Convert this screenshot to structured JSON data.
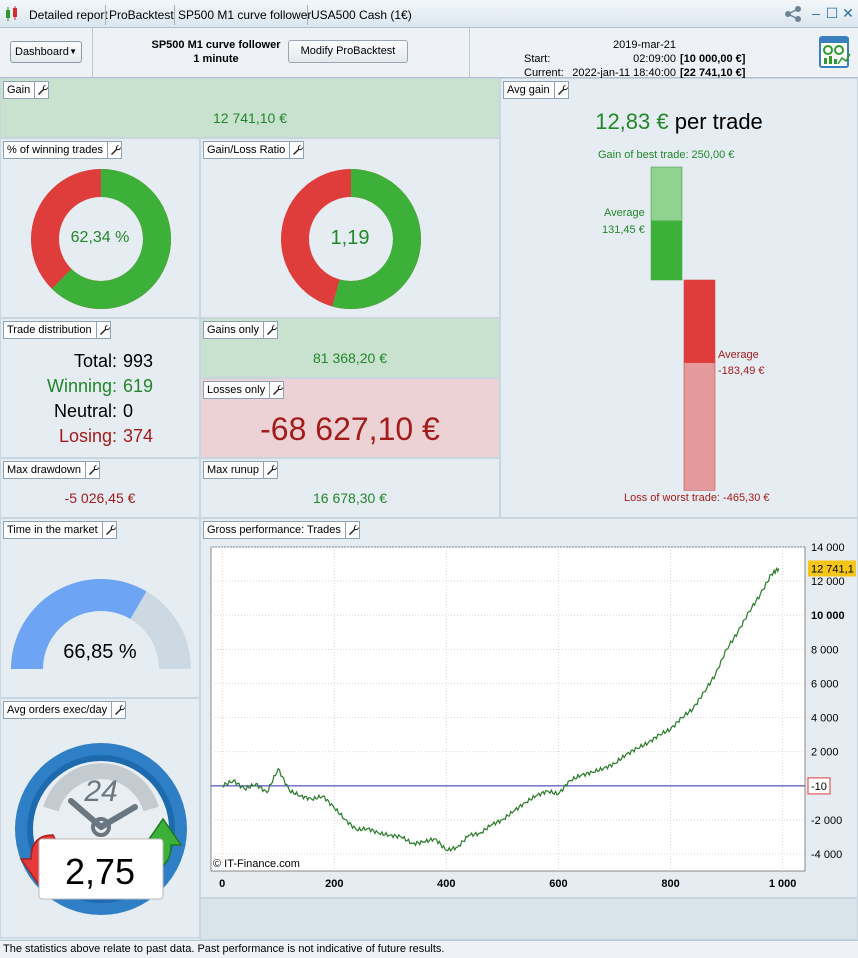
{
  "titlebar": {
    "tabs": [
      "Detailed report",
      "ProBacktest",
      "SP500 M1 curve follower",
      "USA500 Cash (1€)"
    ]
  },
  "header": {
    "dashboard_label": "Dashboard",
    "strategy_name": "SP500 M1 curve follower",
    "timeframe": "1 minute",
    "modify_label": "Modify ProBacktest",
    "start_label": "Start:",
    "start_date": "2019-mar-21 02:09:00",
    "start_capital": "[10 000,00 €]",
    "current_label": "Current:",
    "current_date": "2022-jan-11 18:40:00",
    "current_capital": "[22 741,10 €]"
  },
  "gain": {
    "title": "Gain",
    "value": "12 741,10 €"
  },
  "winning_trades": {
    "title": "% of winning trades",
    "value": "62,34 %",
    "fraction": 0.6234
  },
  "gain_loss_ratio": {
    "title": "Gain/Loss Ratio",
    "value": "1,19",
    "fraction": 0.543
  },
  "avg_gain": {
    "title": "Avg gain",
    "value": "12,83 €",
    "suffix": "per trade",
    "best_trade": "Gain of best trade: 250,00 €",
    "avg_win_label": "Average",
    "avg_win_value": "131,45 €",
    "avg_loss_label": "Average",
    "avg_loss_value": "-183,49 €",
    "worst_trade": "Loss of worst trade: -465,30 €",
    "best": 250.0,
    "avg_win": 131.45,
    "avg_loss": -183.49,
    "worst": -465.3
  },
  "trade_distribution": {
    "title": "Trade distribution",
    "total_label": "Total:",
    "total": "993",
    "winning_label": "Winning:",
    "winning": "619",
    "neutral_label": "Neutral:",
    "neutral": "0",
    "losing_label": "Losing:",
    "losing": "374"
  },
  "gains_only": {
    "title": "Gains only",
    "value": "81 368,20 €"
  },
  "losses_only": {
    "title": "Losses only",
    "value": "-68 627,10 €"
  },
  "max_drawdown": {
    "title": "Max drawdown",
    "value": "-5 026,45 €"
  },
  "max_runup": {
    "title": "Max runup",
    "value": "16 678,30 €"
  },
  "time_in_market": {
    "title": "Time in the market",
    "value": "66,85 %",
    "fraction": 0.6685
  },
  "avg_orders": {
    "title": "Avg orders exec/day",
    "value": "2,75",
    "clock_label": "24"
  },
  "gross_performance": {
    "title": "Gross performance: Trades",
    "watermark": "© IT-Finance.com",
    "last_value_tag": "12 741,1",
    "zero_tag": "-10"
  },
  "chart_data": {
    "type": "line",
    "xlim": [
      -20,
      1040
    ],
    "ylim": [
      -5000,
      14000
    ],
    "x_ticks": [
      "0",
      "200",
      "400",
      "600",
      "800",
      "1 000"
    ],
    "y_ticks": [
      "14 000",
      "12 000",
      "10 000",
      "8 000",
      "6 000",
      "4 000",
      "2 000",
      "-2 000",
      "-4 000"
    ],
    "reference_line": -10,
    "x": [
      0,
      20,
      40,
      60,
      80,
      100,
      120,
      140,
      160,
      180,
      200,
      220,
      240,
      260,
      280,
      300,
      320,
      340,
      360,
      380,
      400,
      420,
      440,
      460,
      480,
      500,
      520,
      540,
      560,
      580,
      600,
      620,
      640,
      660,
      680,
      700,
      720,
      740,
      760,
      780,
      800,
      820,
      840,
      860,
      880,
      900,
      920,
      940,
      960,
      980,
      993
    ],
    "y": [
      0,
      300,
      -200,
      100,
      -400,
      1000,
      -300,
      -600,
      -800,
      -600,
      -1300,
      -2000,
      -2600,
      -2500,
      -2800,
      -2900,
      -3000,
      -3400,
      -3300,
      -3100,
      -3800,
      -3600,
      -2900,
      -2800,
      -2300,
      -2000,
      -1500,
      -1000,
      -600,
      -300,
      -500,
      300,
      600,
      800,
      1000,
      1300,
      1800,
      2200,
      2500,
      3000,
      3300,
      4000,
      4500,
      5500,
      6500,
      8000,
      9000,
      10200,
      11200,
      12400,
      12741
    ]
  },
  "footer": {
    "disclaimer": "The statistics above relate to past data. Past performance is not indicative of future results."
  },
  "colors": {
    "win": "#3cb039",
    "loss": "#df3c3c",
    "curve": "#2a7a2a",
    "baseline": "#2b2bb0",
    "tag_bg": "#f5c518"
  }
}
